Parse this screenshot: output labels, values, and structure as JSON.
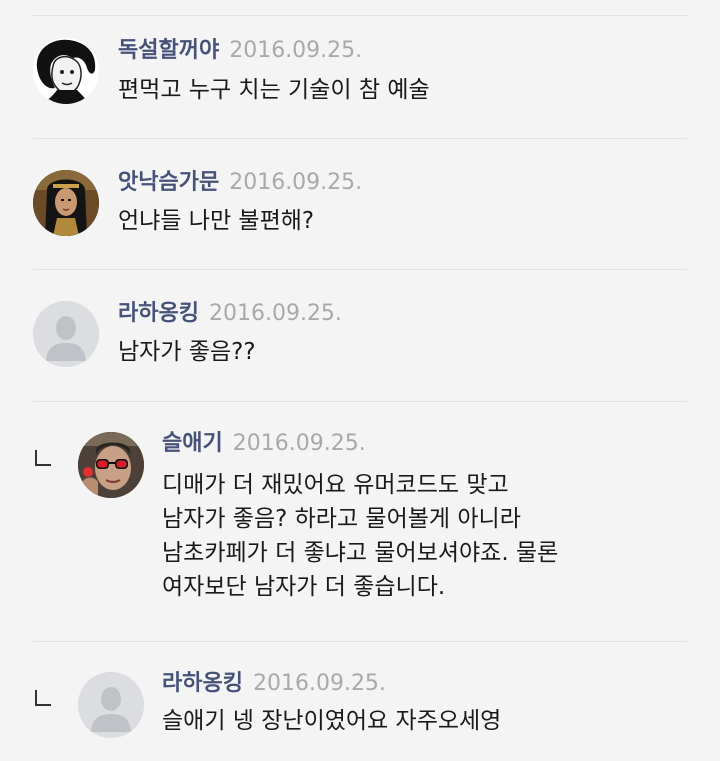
{
  "comments": [
    {
      "author": "독설할꺼야",
      "date": "2016.09.25.",
      "text": "편먹고 누구 치는 기술이 참 예술"
    },
    {
      "author": "앗낙슴가문",
      "date": "2016.09.25.",
      "text": "언냐들 나만 불편해?"
    },
    {
      "author": "라하옹킹",
      "date": "2016.09.25.",
      "text": "남자가 좋음??"
    },
    {
      "author": "슬애기",
      "date": "2016.09.25.",
      "text": "디매가 더 재밌어요 유머코드도 맞고\n남자가 좋음? 하라고 물어볼게 아니라\n남초카페가 더 좋냐고 물어보셔야죠. 물론\n여자보단 남자가 더 좋습니다."
    },
    {
      "author": "라하옹킹",
      "date": "2016.09.25.",
      "text": "슬애기 넹 장난이였어요 자주오세영"
    }
  ],
  "icons": {
    "reply": "reply-arrow-icon",
    "default_avatar": "default-user-icon"
  },
  "colors": {
    "background": "#f4f4f4",
    "author": "#46527a",
    "date": "#a9a9ad",
    "text": "#1a1a1a",
    "divider": "#e2e2e2"
  }
}
